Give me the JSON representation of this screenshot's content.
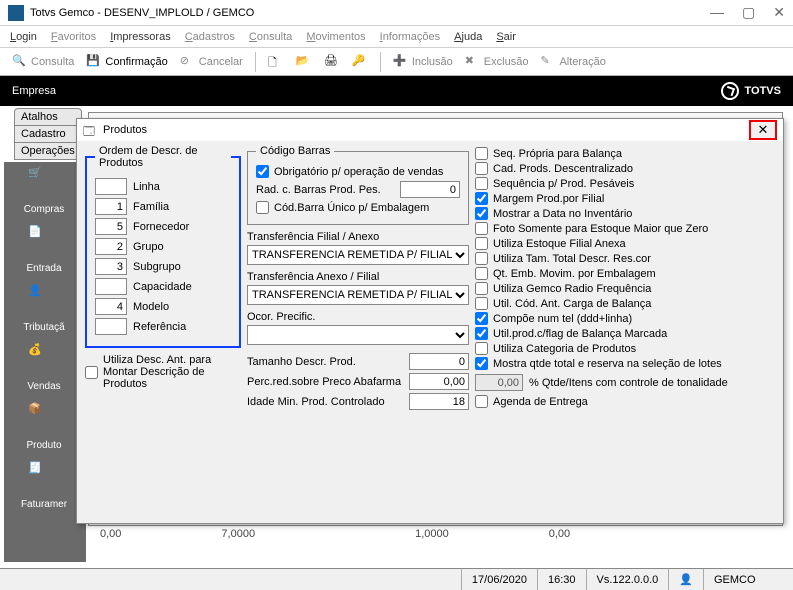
{
  "window": {
    "title": "Totvs Gemco - DESENV_IMPLOLD / GEMCO"
  },
  "menu": {
    "login": "Login",
    "favoritos": "Favoritos",
    "impressoras": "Impressoras",
    "cadastros": "Cadastros",
    "consulta": "Consulta",
    "movimentos": "Movimentos",
    "informacoes": "Informações",
    "ajuda": "Ajuda",
    "sair": "Sair"
  },
  "toolbar": {
    "consulta": "Consulta",
    "confirmacao": "Confirmação",
    "cancelar": "Cancelar",
    "inclusao": "Inclusão",
    "exclusao": "Exclusão",
    "alteracao": "Alteração"
  },
  "empresa": {
    "label": "Empresa",
    "brand": "TOTVS"
  },
  "sidetabs": {
    "atalhos": "Atalhos",
    "cadastro": "Cadastro",
    "operacoes": "Operações"
  },
  "sidebar": {
    "compras": "Compras",
    "entrada": "Entrada",
    "tributacao": "Tributaçã",
    "vendas": "Vendas",
    "produto": "Produto",
    "faturamento": "Faturamer"
  },
  "dialog": {
    "title": "Produtos",
    "ordem": {
      "legend": "Ordem de Descr. de Produtos",
      "linha": {
        "v": "",
        "l": "Linha"
      },
      "familia": {
        "v": "1",
        "l": "Família"
      },
      "fornecedor": {
        "v": "5",
        "l": "Fornecedor"
      },
      "grupo": {
        "v": "2",
        "l": "Grupo"
      },
      "subgrupo": {
        "v": "3",
        "l": "Subgrupo"
      },
      "capacidade": {
        "v": "",
        "l": "Capacidade"
      },
      "modelo": {
        "v": "4",
        "l": "Modelo"
      },
      "referencia": {
        "v": "",
        "l": "Referência"
      }
    },
    "utiliza_desc_ant": "Utiliza Desc. Ant. para Montar Descrição de Produtos",
    "codigo_barras": {
      "legend": "Código Barras",
      "obrigatorio": "Obrigatório p/ operação de vendas",
      "rad": "Rad. c. Barras Prod. Pes.",
      "rad_v": "0",
      "unico": "Cód.Barra Único p/ Embalagem"
    },
    "transf_fa": {
      "l": "Transferência Filial / Anexo",
      "v": "TRANSFERENCIA REMETIDA P/ FILIAL"
    },
    "transf_af": {
      "l": "Transferência Anexo / Filial",
      "v": "TRANSFERENCIA REMETIDA P/ FILIAL"
    },
    "ocor": "Ocor. Precific.",
    "tam_descr": {
      "l": "Tamanho Descr. Prod.",
      "v": "0"
    },
    "perc_red": {
      "l": "Perc.red.sobre Preco Abafarma",
      "v": "0,00"
    },
    "idade_min": {
      "l": "Idade Min. Prod. Controlado",
      "v": "18"
    },
    "right": {
      "seq_balanca": "Seq. Própria para Balança",
      "cad_descentral": "Cad. Prods. Descentralizado",
      "seq_pesaveis": "Sequência p/ Prod. Pesáveis",
      "margem_filial": "Margem Prod.por Filial",
      "mostrar_data": "Mostrar a Data no Inventário",
      "foto_maior_zero": "Foto Somente para Estoque Maior que Zero",
      "estoque_anexa": "Utiliza Estoque Filial Anexa",
      "tam_total": "Utiliza Tam. Total  Descr. Res.cor",
      "qt_emb": "Qt. Emb. Movim. por Embalagem",
      "gemco_radio": "Utiliza Gemco Radio Frequência",
      "cod_ant_balanca": "Util. Cód. Ant. Carga de Balança",
      "compoe_tel": "Compõe num tel (ddd+linha)",
      "flag_balanca": "Util.prod.c/flag de Balança Marcada",
      "categoria": "Utiliza Categoria de Produtos",
      "qtde_total": "Mostra qtde total e reserva na seleção de lotes",
      "tonalidade": {
        "v": "0,00",
        "l": "% Qtde/Itens com controle de tonalidade"
      },
      "agenda": "Agenda de Entrega"
    }
  },
  "nums": {
    "a": "0,00",
    "b": "7,0000",
    "c": "1,0000",
    "d": "0,00"
  },
  "status": {
    "date": "17/06/2020",
    "time": "16:30",
    "version": "Vs.122.0.0.0",
    "user": "GEMCO"
  }
}
